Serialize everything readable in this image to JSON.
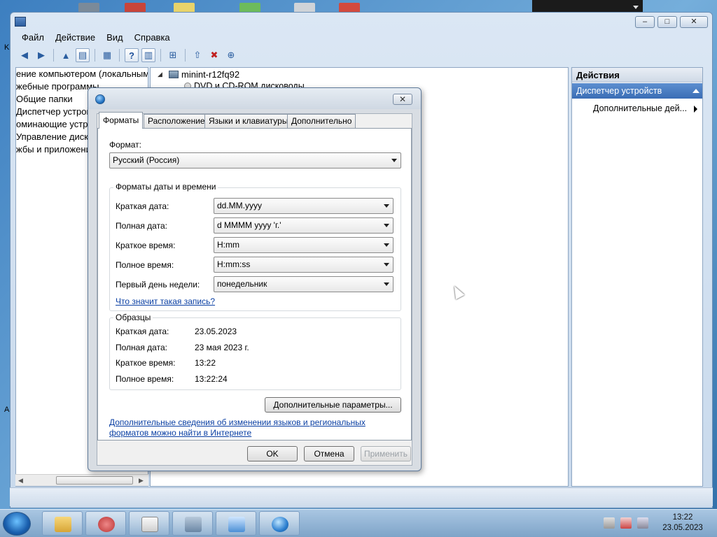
{
  "mmc": {
    "menu": [
      "Файл",
      "Действие",
      "Вид",
      "Справка"
    ],
    "window_buttons": {
      "minimize": "–",
      "maximize": "□",
      "close": "✕"
    }
  },
  "left_tree": [
    "ение компьютером (локальным)",
    "жебные программы",
    "Общие папки",
    "Диспетчер устройств",
    "оминающие устро",
    "Управление дискам",
    "жбы и приложени"
  ],
  "center_tree": {
    "computer": "minint-r12fq92",
    "child": "DVD и CD-ROM дисководы"
  },
  "actions": {
    "header": "Действия",
    "section": "Диспетчер устройств",
    "item": "Дополнительные дей..."
  },
  "dialog": {
    "close_glyph": "✕",
    "tabs": [
      "Форматы",
      "Расположение",
      "Языки и клавиатуры",
      "Дополнительно"
    ],
    "format_label": "Формат:",
    "format_value": "Русский (Россия)",
    "datetime_group": "Форматы даты и времени",
    "fields": [
      {
        "label": "Краткая дата:",
        "value": "dd.MM.yyyy"
      },
      {
        "label": "Полная дата:",
        "value": "d MMMM yyyy 'г.'"
      },
      {
        "label": "Краткое время:",
        "value": "H:mm"
      },
      {
        "label": "Полное время:",
        "value": "H:mm:ss"
      },
      {
        "label": "Первый день недели:",
        "value": "понедельник"
      }
    ],
    "what_link": "Что значит такая запись?",
    "samples_group": "Образцы",
    "samples": [
      {
        "label": "Краткая дата:",
        "value": "23.05.2023"
      },
      {
        "label": "Полная дата:",
        "value": "23 мая 2023 г."
      },
      {
        "label": "Краткое время:",
        "value": "13:22"
      },
      {
        "label": "Полное время:",
        "value": "13:22:24"
      }
    ],
    "advanced_button": "Дополнительные параметры...",
    "info_link_line1": "Дополнительные сведения об изменении языков и региональных",
    "info_link_line2": "форматов можно найти в Интернете",
    "ok": "OK",
    "cancel": "Отмена",
    "apply": "Применить"
  },
  "taskbar": {
    "time": "13:22",
    "date": "23.05.2023"
  }
}
